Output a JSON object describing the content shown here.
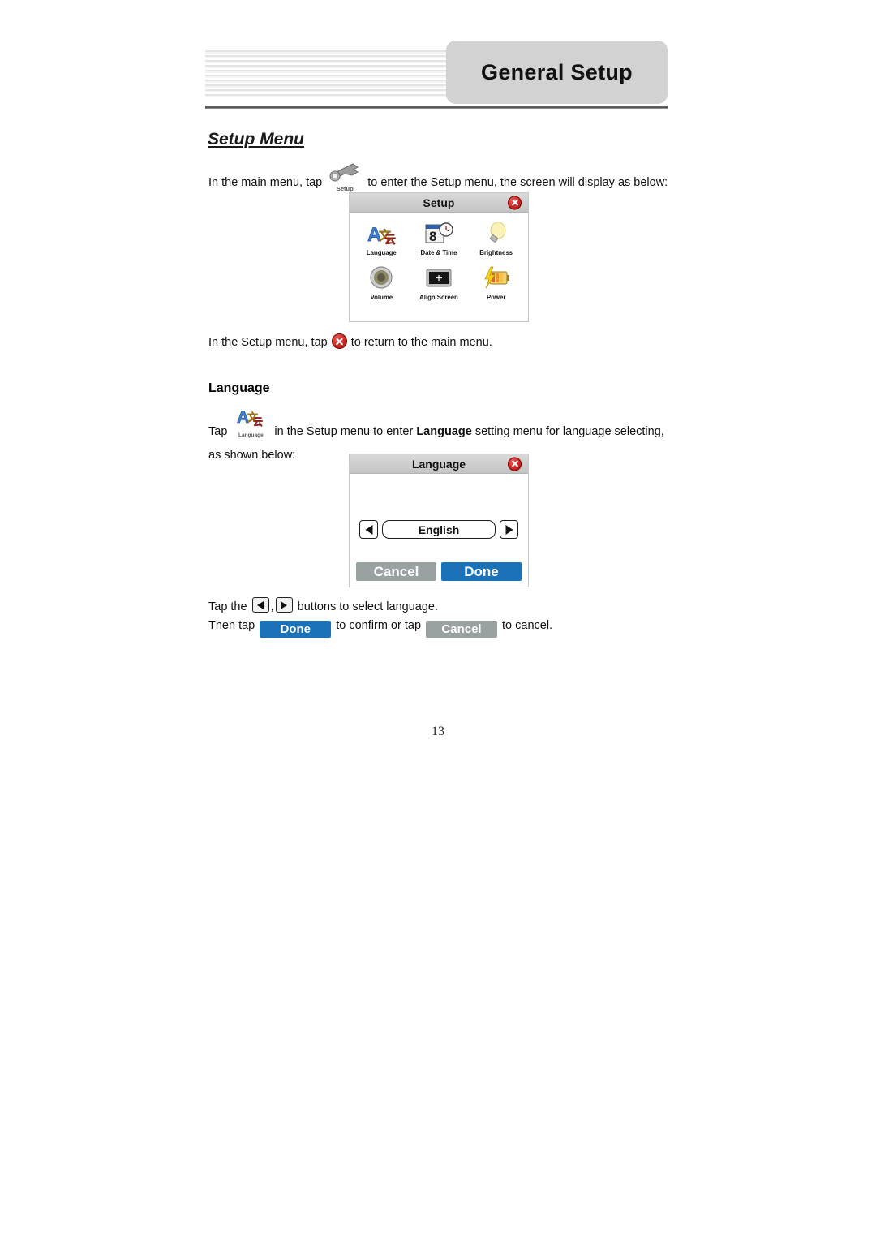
{
  "header": {
    "badge_title": "General Setup"
  },
  "section": {
    "title": "Setup Menu"
  },
  "body": {
    "intro_before": "In the main menu, tap",
    "intro_after": "to enter the Setup menu, the screen will display as below:",
    "return_before": "In the Setup menu, tap",
    "return_after": "to return to the main menu.",
    "language_heading": "Language",
    "lang_tap_before": "Tap",
    "lang_tap_mid": "in the Setup menu to enter",
    "lang_tap_bold": "Language",
    "lang_tap_after": "setting menu for language selecting, as shown below:",
    "tapbtns_before": "Tap the",
    "tapbtns_comma": ",",
    "tapbtns_after": "buttons to select language.",
    "thentap_before": "Then tap",
    "thentap_mid": "to confirm or tap",
    "thentap_after": "to cancel."
  },
  "inline_icons": {
    "setup_label": "Setup",
    "language_label": "Language",
    "done_label": "Done",
    "cancel_label": "Cancel"
  },
  "setup_dialog": {
    "title": "Setup",
    "close_icon": "close-x-icon",
    "items": [
      {
        "label": "Language",
        "icon": "language-abc-icon"
      },
      {
        "label": "Date & Time",
        "icon": "calendar-clock-icon"
      },
      {
        "label": "Brightness",
        "icon": "lightbulb-icon"
      },
      {
        "label": "Volume",
        "icon": "speaker-icon"
      },
      {
        "label": "Align Screen",
        "icon": "align-screen-icon"
      },
      {
        "label": "Power",
        "icon": "battery-bolt-icon"
      }
    ]
  },
  "language_dialog": {
    "title": "Language",
    "close_icon": "close-x-icon",
    "prev_icon": "triangle-left-icon",
    "next_icon": "triangle-right-icon",
    "value": "English",
    "cancel_label": "Cancel",
    "done_label": "Done"
  },
  "footer": {
    "page_number": "13"
  },
  "colors": {
    "badge_bg": "#d2d2d2",
    "titlebar_bg": "#c9c9c9",
    "close_red": "#c8201c",
    "done_blue": "#1b72b8",
    "cancel_gray": "#9aa1a1"
  }
}
